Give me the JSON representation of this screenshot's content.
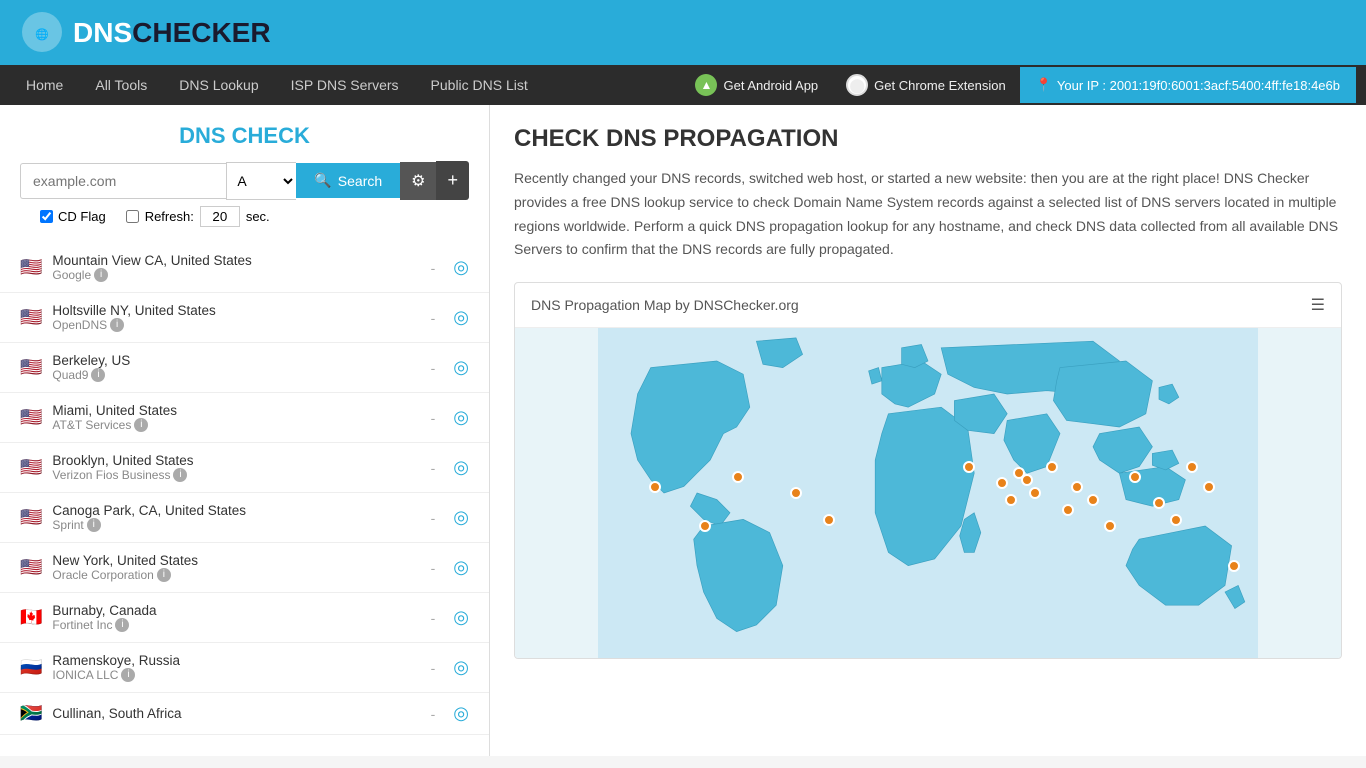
{
  "header": {
    "logo_dns": "DNS",
    "logo_checker": "CHECKER",
    "ip_label": "Your IP : 2001:19f0:6001:3acf:5400:4ff:fe18:4e6b"
  },
  "nav": {
    "items": [
      {
        "label": "Home",
        "id": "home"
      },
      {
        "label": "All Tools",
        "id": "all-tools"
      },
      {
        "label": "DNS Lookup",
        "id": "dns-lookup"
      },
      {
        "label": "ISP DNS Servers",
        "id": "isp-dns"
      },
      {
        "label": "Public DNS List",
        "id": "public-dns"
      }
    ],
    "android_btn": "Get Android App",
    "chrome_btn": "Get Chrome Extension"
  },
  "sidebar": {
    "title": "DNS CHECK",
    "search": {
      "placeholder": "example.com",
      "record_type": "A",
      "button_label": "Search"
    },
    "options": {
      "cd_flag_label": "CD Flag",
      "cd_flag_checked": true,
      "refresh_label": "Refresh:",
      "refresh_checked": false,
      "refresh_value": "20",
      "refresh_unit": "sec."
    },
    "servers": [
      {
        "flag": "🇺🇸",
        "name": "Mountain View CA, United States",
        "provider": "Google",
        "has_info": true
      },
      {
        "flag": "🇺🇸",
        "name": "Holtsville NY, United States",
        "provider": "OpenDNS",
        "has_info": true
      },
      {
        "flag": "🇺🇸",
        "name": "Berkeley, US",
        "provider": "Quad9",
        "has_info": true
      },
      {
        "flag": "🇺🇸",
        "name": "Miami, United States",
        "provider": "AT&T Services",
        "has_info": true
      },
      {
        "flag": "🇺🇸",
        "name": "Brooklyn, United States",
        "provider": "Verizon Fios Business",
        "has_info": true
      },
      {
        "flag": "🇺🇸",
        "name": "Canoga Park, CA, United States",
        "provider": "Sprint",
        "has_info": true
      },
      {
        "flag": "🇺🇸",
        "name": "New York, United States",
        "provider": "Oracle Corporation",
        "has_info": true
      },
      {
        "flag": "🇨🇦",
        "name": "Burnaby, Canada",
        "provider": "Fortinet Inc",
        "has_info": true
      },
      {
        "flag": "🇷🇺",
        "name": "Ramenskoye, Russia",
        "provider": "IONICA LLC",
        "has_info": true
      },
      {
        "flag": "🇿🇦",
        "name": "Cullinan, South Africa",
        "provider": "",
        "has_info": false
      }
    ]
  },
  "content": {
    "title": "CHECK DNS PROPAGATION",
    "description": "Recently changed your DNS records, switched web host, or started a new website: then you are at the right place! DNS Checker provides a free DNS lookup service to check Domain Name System records against a selected list of DNS servers located in multiple regions worldwide. Perform a quick DNS propagation lookup for any hostname, and check DNS data collected from all available DNS Servers to confirm that the DNS records are fully propagated.",
    "map": {
      "title": "DNS Propagation Map by DNSChecker.org"
    }
  },
  "markers": [
    {
      "x": 17,
      "y": 48
    },
    {
      "x": 23,
      "y": 60
    },
    {
      "x": 27,
      "y": 45
    },
    {
      "x": 34,
      "y": 50
    },
    {
      "x": 38,
      "y": 58
    },
    {
      "x": 55,
      "y": 42
    },
    {
      "x": 59,
      "y": 47
    },
    {
      "x": 60,
      "y": 52
    },
    {
      "x": 61,
      "y": 44
    },
    {
      "x": 62,
      "y": 46
    },
    {
      "x": 63,
      "y": 50
    },
    {
      "x": 65,
      "y": 42
    },
    {
      "x": 67,
      "y": 55
    },
    {
      "x": 68,
      "y": 48
    },
    {
      "x": 70,
      "y": 52
    },
    {
      "x": 72,
      "y": 60
    },
    {
      "x": 75,
      "y": 45
    },
    {
      "x": 78,
      "y": 53
    },
    {
      "x": 80,
      "y": 58
    },
    {
      "x": 82,
      "y": 42
    },
    {
      "x": 84,
      "y": 48
    },
    {
      "x": 87,
      "y": 72
    }
  ]
}
